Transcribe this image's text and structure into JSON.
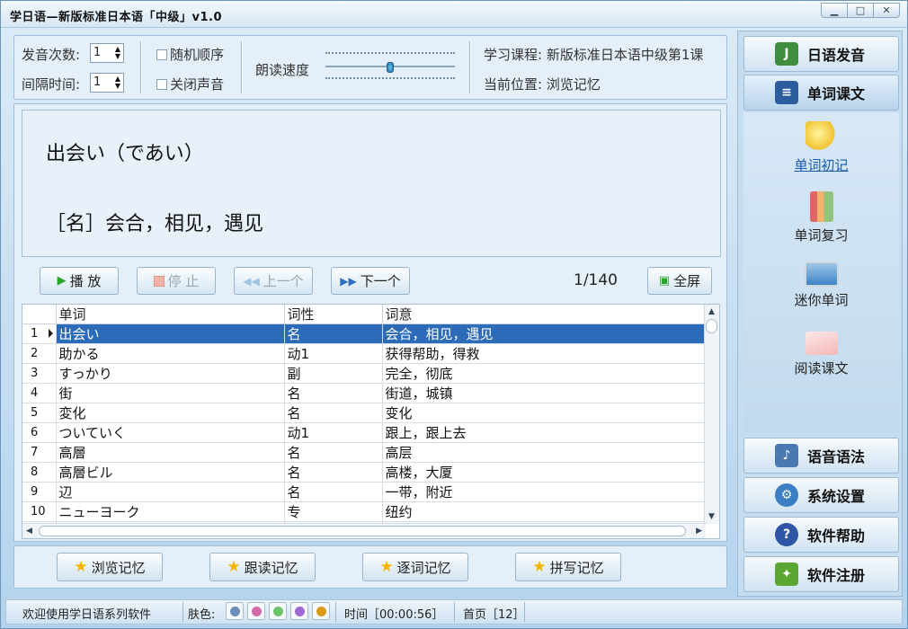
{
  "window": {
    "title": "学日语—新版标准日本语「中级」v1.0",
    "btn_min": "▁",
    "btn_max": "□",
    "btn_close": "✕"
  },
  "controls": {
    "repeat_label": "发音次数:",
    "repeat_value": "1",
    "interval_label": "间隔时间:",
    "interval_value": "1",
    "random_label": "随机顺序",
    "mute_label": "关闭声音",
    "speed_label": "朗读速度",
    "course": "学习课程: 新版标准日本语中级第1课",
    "position": "当前位置: 浏览记忆"
  },
  "display": {
    "word": "出会い（であい）",
    "meaning": "［名］会合，相见，遇见"
  },
  "toolbar": {
    "play": "播 放",
    "stop": "停 止",
    "prev": "上一个",
    "next": "下一个",
    "counter": "1/140",
    "fullscreen": "全屏"
  },
  "table": {
    "headers": [
      "单词",
      "词性",
      "词意"
    ],
    "rows": [
      {
        "n": "1",
        "word": "出会い",
        "pos": "名",
        "meaning": "会合，相见，遇见"
      },
      {
        "n": "2",
        "word": "助かる",
        "pos": "动1",
        "meaning": "获得帮助，得救"
      },
      {
        "n": "3",
        "word": "すっかり",
        "pos": "副",
        "meaning": "完全，彻底"
      },
      {
        "n": "4",
        "word": "街",
        "pos": "名",
        "meaning": "街道，城镇"
      },
      {
        "n": "5",
        "word": "変化",
        "pos": "名",
        "meaning": "变化"
      },
      {
        "n": "6",
        "word": "ついていく",
        "pos": "动1",
        "meaning": "跟上，跟上去"
      },
      {
        "n": "7",
        "word": "高層",
        "pos": "名",
        "meaning": "高层"
      },
      {
        "n": "8",
        "word": "高層ビル",
        "pos": "名",
        "meaning": "高楼，大厦"
      },
      {
        "n": "9",
        "word": "辺",
        "pos": "名",
        "meaning": "一带，附近"
      },
      {
        "n": "10",
        "word": "ニューヨーク",
        "pos": "专",
        "meaning": "纽约"
      }
    ]
  },
  "modes": {
    "browse": "浏览记忆",
    "follow": "跟读记忆",
    "word_by_word": "逐词记忆",
    "spelling": "拼写记忆"
  },
  "sidebar": {
    "pronunciation": "日语发音",
    "vocab": "单词课文",
    "sub": {
      "first": "单词初记",
      "review": "单词复习",
      "mini": "迷你单词",
      "read": "阅读课文"
    },
    "grammar": "语音语法",
    "settings": "系统设置",
    "help": "软件帮助",
    "register": "软件注册"
  },
  "status": {
    "welcome": "欢迎使用学日语系列软件",
    "skin_label": "肤色:",
    "skin_colors": [
      "#6b8fb8",
      "#d46aa6",
      "#6cc46c",
      "#9f6ad4",
      "#d99a1a"
    ],
    "time": "时间［00:00:56］",
    "page": "首页［12］"
  }
}
